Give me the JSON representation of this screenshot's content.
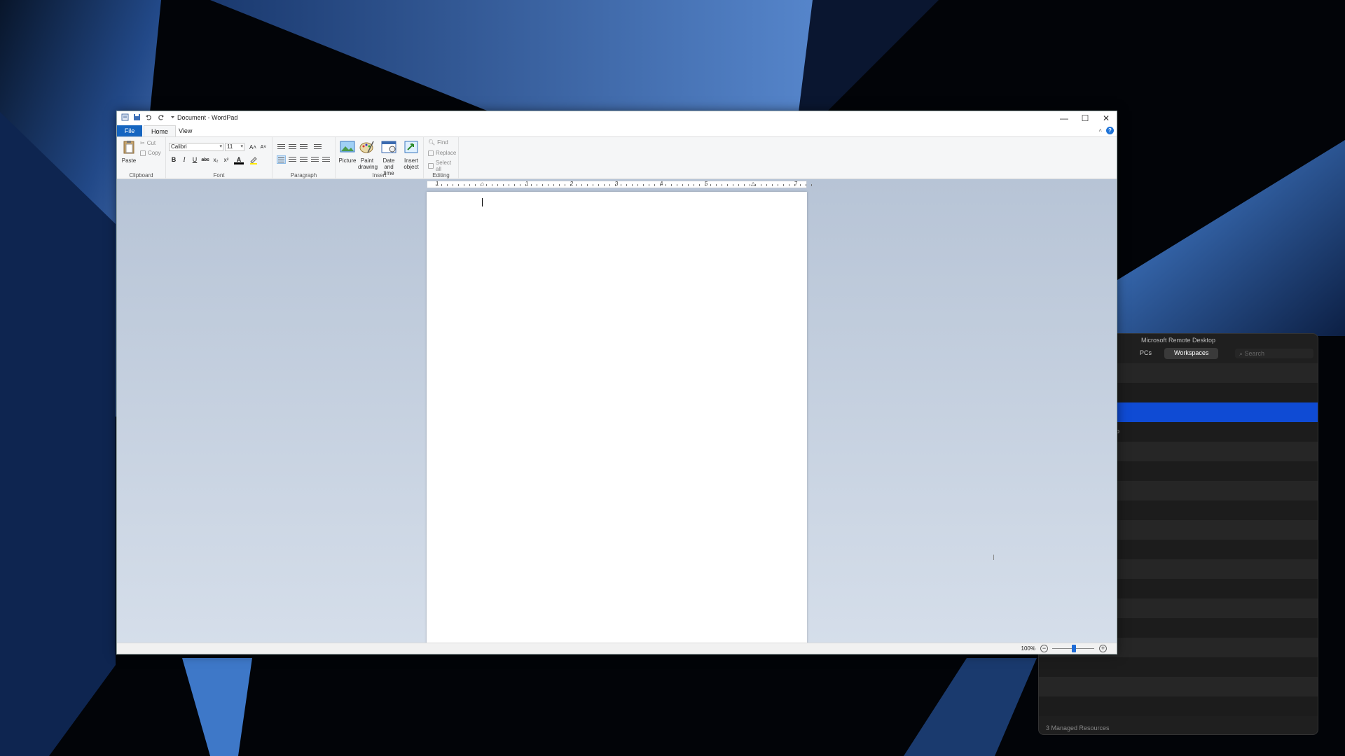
{
  "titlebar": {
    "title": "Document - WordPad",
    "minimize": "—",
    "maximize": "☐",
    "close": "✕"
  },
  "menubar": {
    "file": "File",
    "home": "Home",
    "view": "View",
    "help": "?"
  },
  "ribbon": {
    "clipboard": {
      "label": "Clipboard",
      "paste": "Paste",
      "cut": "Cut",
      "copy": "Copy"
    },
    "font": {
      "label": "Font",
      "font_name": "Calibri",
      "font_size": "11",
      "bold": "B",
      "italic": "I",
      "underline": "U",
      "strike": "abc",
      "subscript": "x₂",
      "superscript": "x²",
      "grow": "A˄",
      "shrink": "A˅",
      "color": "A"
    },
    "paragraph": {
      "label": "Paragraph"
    },
    "insert": {
      "label": "Insert",
      "picture": "Picture",
      "paint": [
        "Paint",
        "drawing"
      ],
      "datetime": [
        "Date and",
        "time"
      ],
      "object": [
        "Insert",
        "object"
      ]
    },
    "editing": {
      "label": "Editing",
      "find": "Find",
      "replace": "Replace",
      "select_all": "Select all"
    }
  },
  "ruler": {
    "numbers": [
      "1",
      "1",
      "2",
      "3",
      "4",
      "5",
      "7"
    ]
  },
  "status": {
    "zoom": "100%",
    "zoom_out": "−",
    "zoom_in": "+",
    "zoom_level": 1.0
  },
  "remote_desktop": {
    "title": "Microsoft Remote Desktop",
    "tabs": [
      "PCs",
      "Workspaces"
    ],
    "selected_tab": "Workspaces",
    "search_placeholder": "Search",
    "row_fragment": "p",
    "footer": "3 Managed Resources"
  },
  "colors": {
    "accent": "#1565c0",
    "selection": "#0f4bd4"
  }
}
